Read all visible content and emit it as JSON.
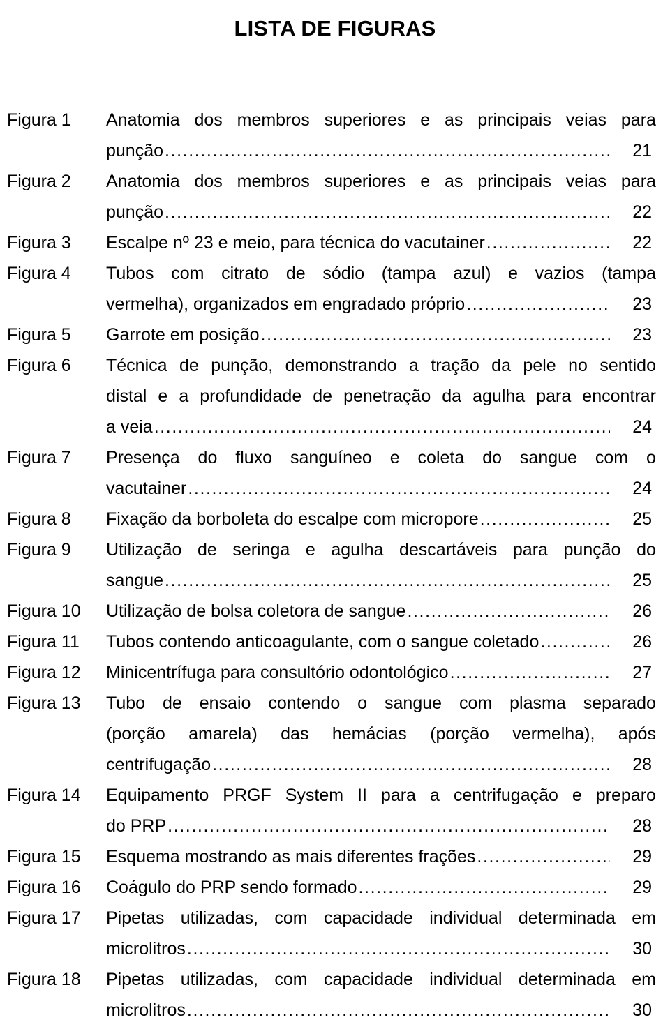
{
  "document": {
    "title": "LISTA DE FIGURAS",
    "language": "pt-BR"
  },
  "figures": [
    {
      "label": "Figura 1",
      "caption": "Anatomia dos membros superiores e as principais veias para punção",
      "page": "21",
      "lines": [
        {
          "text": "Anatomia dos membros superiores e as principais veias para",
          "final": false
        },
        {
          "text": "punção",
          "final": true
        }
      ]
    },
    {
      "label": "Figura 2",
      "caption": "Anatomia dos membros superiores e as principais veias para punção",
      "page": "22",
      "lines": [
        {
          "text": "Anatomia dos membros superiores e as principais veias para",
          "final": false
        },
        {
          "text": "punção",
          "final": true
        }
      ]
    },
    {
      "label": "Figura 3",
      "caption": "Escalpe nº 23 e meio, para técnica do vacutainer",
      "page": "22",
      "lines": [
        {
          "text": "Escalpe nº 23 e meio, para técnica do vacutainer",
          "final": true
        }
      ]
    },
    {
      "label": "Figura 4",
      "caption": "Tubos com citrato de sódio (tampa azul) e vazios (tampa vermelha), organizados em engradado próprio",
      "page": "23",
      "lines": [
        {
          "text": "Tubos com citrato de sódio (tampa azul) e vazios (tampa",
          "final": false
        },
        {
          "text": "vermelha), organizados em engradado próprio",
          "final": true
        }
      ]
    },
    {
      "label": "Figura 5",
      "caption": "Garrote em posição",
      "page": "23",
      "lines": [
        {
          "text": "Garrote em posição",
          "final": true
        }
      ]
    },
    {
      "label": "Figura 6",
      "caption": "Técnica de punção, demonstrando a tração da pele no sentido distal e a profundidade de penetração da agulha para encontrar a veia",
      "page": "24",
      "lines": [
        {
          "text": "Técnica de punção, demonstrando a tração da pele no sentido",
          "final": false
        },
        {
          "text": "distal e a profundidade de penetração da agulha para encontrar",
          "final": false
        },
        {
          "text": "a veia",
          "final": true
        }
      ]
    },
    {
      "label": "Figura 7",
      "caption": "Presença do fluxo sanguíneo e coleta do sangue com o vacutainer",
      "page": "24",
      "lines": [
        {
          "text": "Presença do fluxo sanguíneo e coleta do sangue com o",
          "final": false
        },
        {
          "text": "vacutainer",
          "final": true
        }
      ]
    },
    {
      "label": "Figura 8",
      "caption": "Fixação da borboleta do escalpe com micropore",
      "page": "25",
      "lines": [
        {
          "text": "Fixação da borboleta do escalpe com micropore",
          "final": true
        }
      ]
    },
    {
      "label": "Figura 9",
      "caption": "Utilização de seringa e agulha descartáveis para punção do sangue",
      "page": "25",
      "lines": [
        {
          "text": "Utilização de seringa e agulha descartáveis para punção do",
          "final": false
        },
        {
          "text": "sangue",
          "final": true
        }
      ]
    },
    {
      "label": "Figura 10",
      "caption": "Utilização de bolsa coletora de sangue",
      "page": "26",
      "lines": [
        {
          "text": "Utilização de bolsa coletora de sangue",
          "final": true
        }
      ]
    },
    {
      "label": "Figura 11",
      "caption": "Tubos contendo anticoagulante, com o sangue coletado",
      "page": "26",
      "lines": [
        {
          "text": "Tubos contendo anticoagulante, com o sangue coletado",
          "final": true
        }
      ]
    },
    {
      "label": "Figura 12",
      "caption": "Minicentrífuga para consultório odontológico",
      "page": "27",
      "lines": [
        {
          "text": "Minicentrífuga para consultório odontológico",
          "final": true
        }
      ]
    },
    {
      "label": "Figura 13",
      "caption": "Tubo de ensaio contendo o sangue com plasma separado (porção amarela) das hemácias (porção vermelha), após centrifugação",
      "page": "28",
      "lines": [
        {
          "text": "Tubo de ensaio contendo o sangue com plasma separado",
          "final": false
        },
        {
          "text": "(porção amarela) das hemácias (porção vermelha), após",
          "final": false
        },
        {
          "text": "centrifugação",
          "final": true
        }
      ]
    },
    {
      "label": "Figura 14",
      "caption": "Equipamento PRGF System II para a centrifugação e preparo do PRP",
      "page": "28",
      "lines": [
        {
          "text": "Equipamento PRGF System II para a centrifugação e preparo",
          "final": false
        },
        {
          "text": "do PRP",
          "final": true
        }
      ]
    },
    {
      "label": "Figura 15",
      "caption": "Esquema mostrando as mais diferentes frações",
      "page": "29",
      "lines": [
        {
          "text": "Esquema mostrando as mais diferentes frações",
          "final": true
        }
      ]
    },
    {
      "label": "Figura 16",
      "caption": "Coágulo do PRP sendo formado",
      "page": "29",
      "lines": [
        {
          "text": "Coágulo do PRP sendo formado",
          "final": true
        }
      ]
    },
    {
      "label": "Figura 17",
      "caption": "Pipetas utilizadas, com capacidade individual determinada em microlitros",
      "page": "30",
      "lines": [
        {
          "text": "Pipetas utilizadas, com capacidade individual determinada em",
          "final": false
        },
        {
          "text": "microlitros",
          "final": true
        }
      ]
    },
    {
      "label": "Figura 18",
      "caption": "Pipetas utilizadas, com capacidade individual determinada em microlitros",
      "page": "30",
      "lines": [
        {
          "text": "Pipetas utilizadas, com capacidade individual determinada em",
          "final": false
        },
        {
          "text": "microlitros",
          "final": true
        }
      ]
    }
  ]
}
